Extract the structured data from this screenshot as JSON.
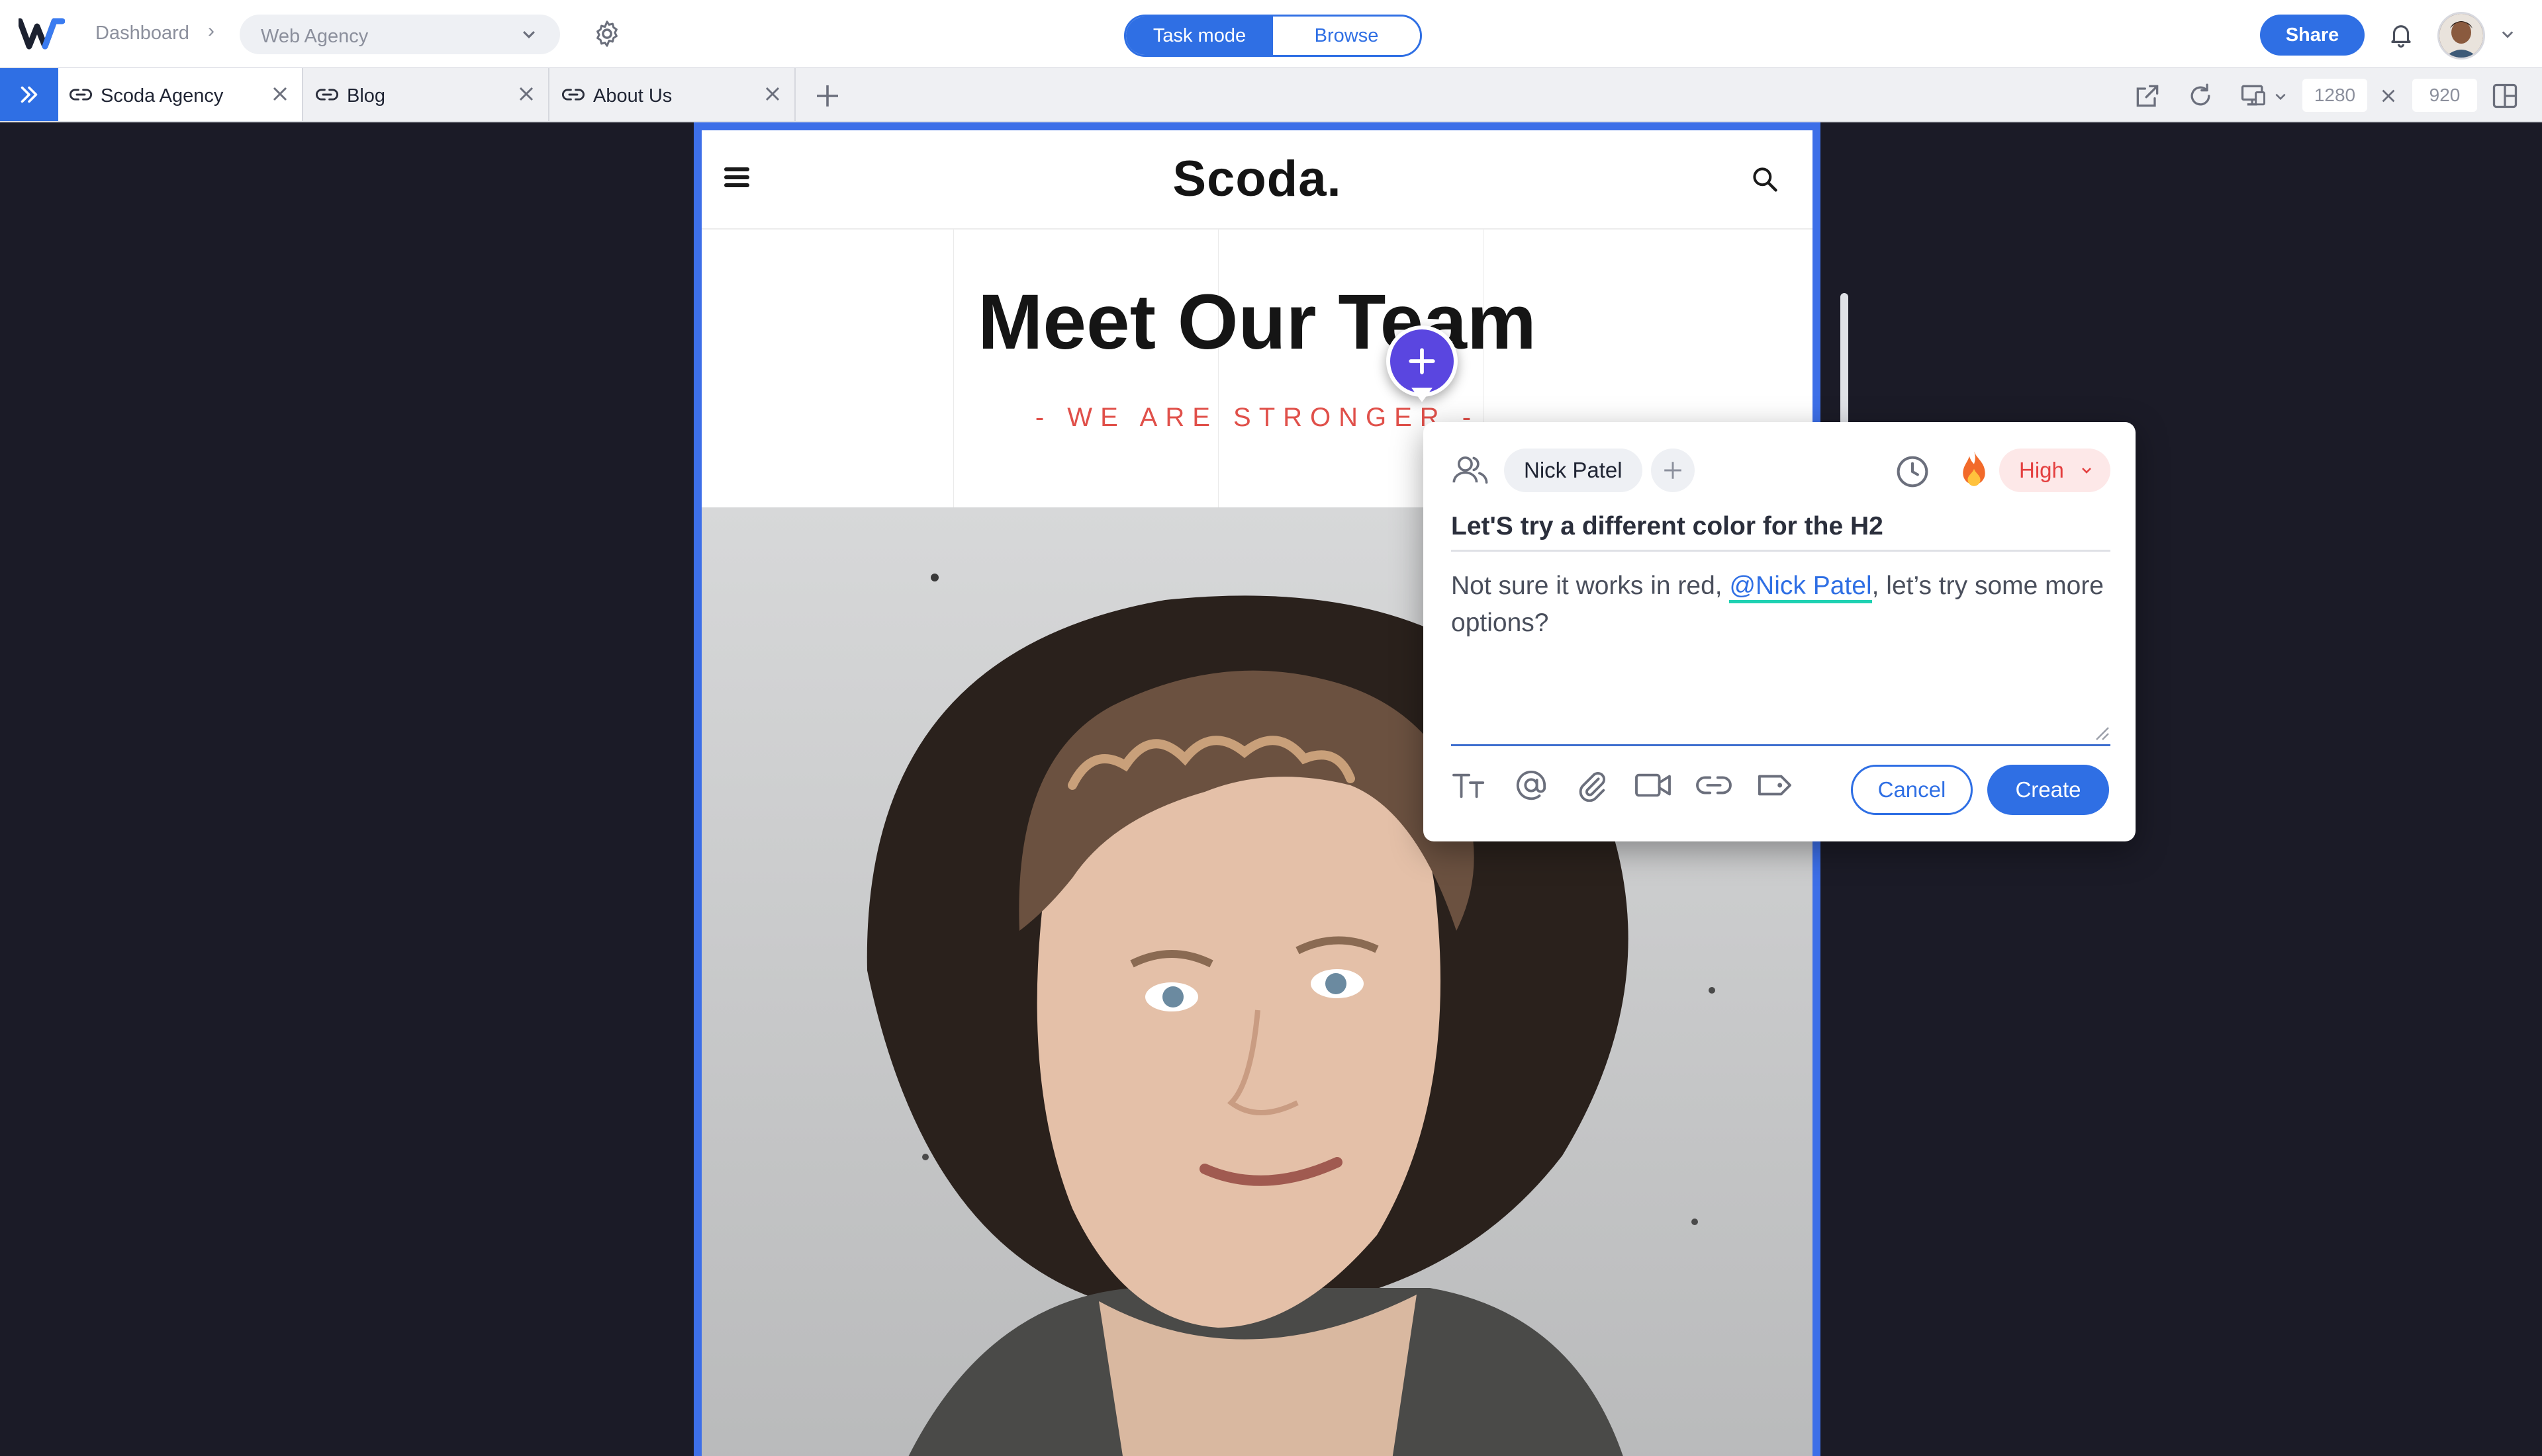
{
  "topbar": {
    "breadcrumb_root": "Dashboard",
    "project": "Web Agency",
    "modes": {
      "active": "Task mode",
      "inactive": "Browse"
    },
    "share_label": "Share"
  },
  "tabs": [
    {
      "label": "Scoda Agency",
      "active": true
    },
    {
      "label": "Blog",
      "active": false
    },
    {
      "label": "About Us",
      "active": false
    }
  ],
  "viewport": {
    "width": "1280",
    "height": "920"
  },
  "site": {
    "brand": "Scoda.",
    "hero_title": "Meet Our Team",
    "hero_subtitle": "- WE ARE STRONGER -"
  },
  "task": {
    "assignee": "Nick Patel",
    "priority": "High",
    "title": "Let'S  try a different color for the H2",
    "description_before": "Not sure it works in red, ",
    "mention": "@Nick Patel",
    "description_after": ", let’s try some more options?",
    "cancel_label": "Cancel",
    "create_label": "Create"
  },
  "colors": {
    "accent": "#2f6fe4",
    "frame_outline": "#3d6fe8",
    "marker": "#5a46e0",
    "priority_high": "#e44040",
    "mention_underline": "#1fd1b2",
    "hero_subtitle": "#e0504a"
  }
}
